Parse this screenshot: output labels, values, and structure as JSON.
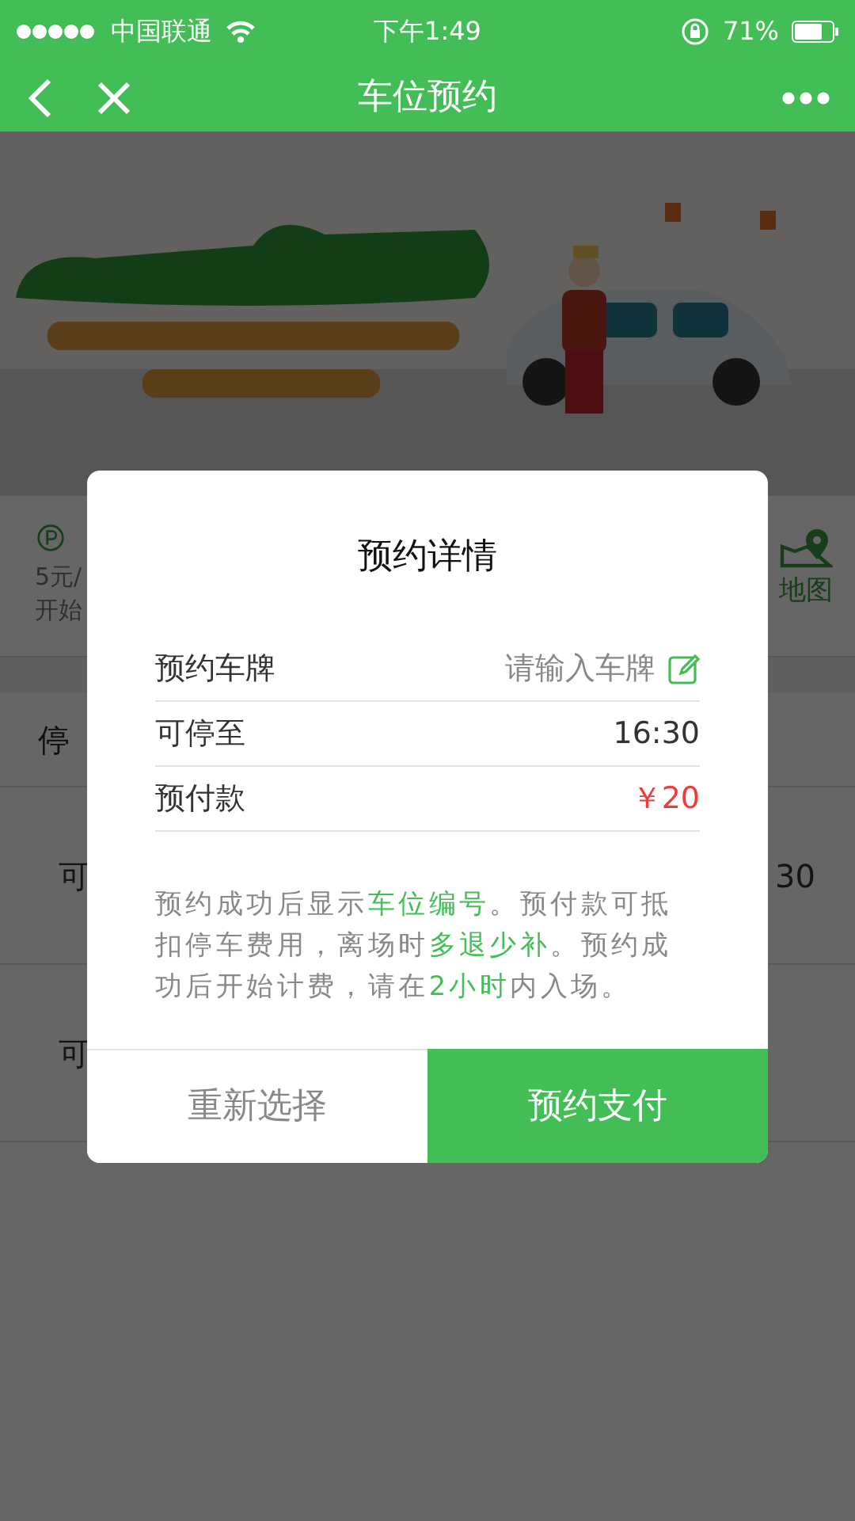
{
  "status_bar": {
    "carrier": "中国联通",
    "time": "下午1:49",
    "battery": "71%"
  },
  "nav": {
    "title": "车位预约"
  },
  "background": {
    "info_lines": [
      "5元/",
      "开始"
    ],
    "map_label": "地图",
    "section_title": "停",
    "rows": [
      {
        "label": "可",
        "value": "30"
      },
      {
        "label": "可"
      }
    ]
  },
  "dialog": {
    "title": "预约详情",
    "rows": [
      {
        "kind": "input",
        "label": "预约车牌",
        "placeholder": "请输入车牌"
      },
      {
        "kind": "text",
        "label": "可停至",
        "value": "16:30"
      },
      {
        "kind": "price",
        "label": "预付款",
        "value": "￥20"
      }
    ],
    "note": [
      {
        "text": "预约成功后显示",
        "highlight": false
      },
      {
        "text": "车位编号",
        "highlight": true
      },
      {
        "text": "。预付款可抵扣停车费用，离场时",
        "highlight": false
      },
      {
        "text": "多退少补",
        "highlight": true
      },
      {
        "text": "。预约成功后开始计费，请在",
        "highlight": false
      },
      {
        "text": "2小时",
        "highlight": true
      },
      {
        "text": "内入场。",
        "highlight": false
      }
    ],
    "buttons": [
      {
        "kind": "secondary",
        "label": "重新选择"
      },
      {
        "kind": "primary",
        "label": "预约支付"
      }
    ]
  }
}
